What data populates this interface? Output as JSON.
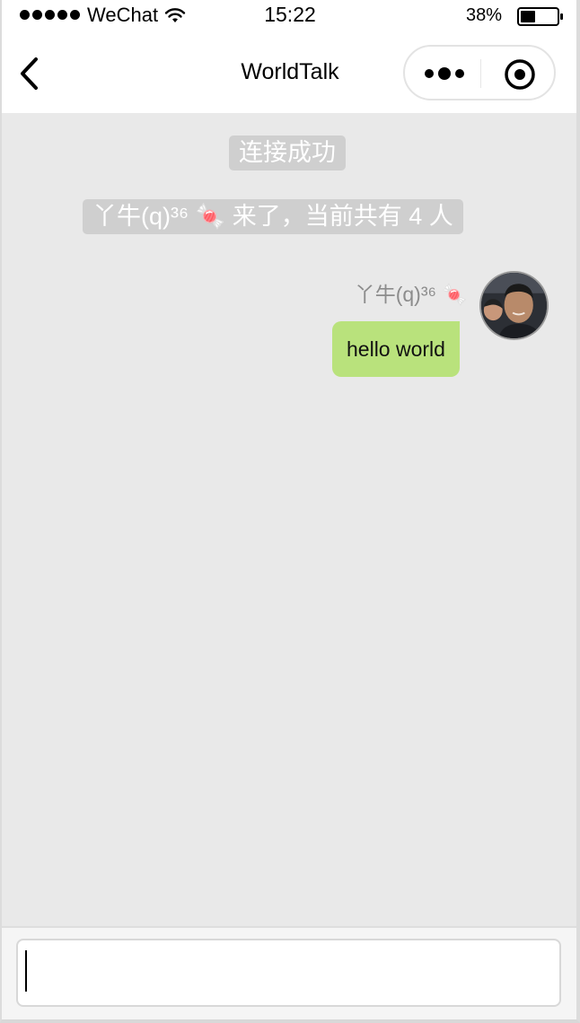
{
  "status_bar": {
    "carrier": "WeChat",
    "time": "15:22",
    "battery": "38%"
  },
  "nav": {
    "title": "WorldTalk"
  },
  "chat": {
    "system_messages": [
      "连接成功",
      "丫牛(q)³⁶ 🍬 来了，当前共有 4 人"
    ],
    "messages": [
      {
        "sender": "丫牛(q)³⁶ 🍬",
        "text": "hello world",
        "side": "right"
      }
    ]
  },
  "input": {
    "value": "",
    "placeholder": ""
  },
  "colors": {
    "chat_background": "#e9e9e9",
    "bubble_self": "#b9e27c",
    "system_badge": "#cfcfcf"
  }
}
